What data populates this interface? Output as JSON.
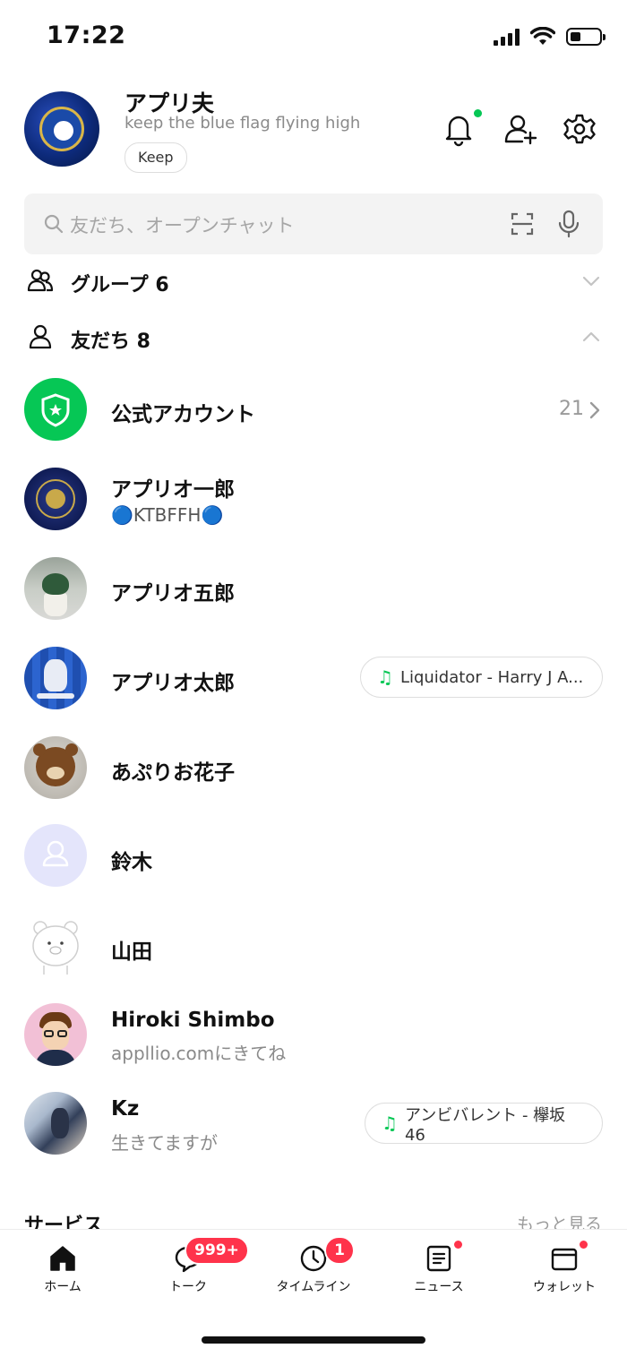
{
  "status_bar": {
    "time": "17:22"
  },
  "profile": {
    "name": "アプリ夫",
    "status_message": "keep the blue flag flying high",
    "keep_label": "Keep"
  },
  "search": {
    "placeholder": "友だち、オープンチャット"
  },
  "sections": {
    "groups": {
      "label": "グループ 6",
      "expanded": false
    },
    "friends": {
      "label": "友だち 8",
      "expanded": true
    }
  },
  "official": {
    "label": "公式アカウント",
    "count": "21"
  },
  "friends": [
    {
      "name": "アプリオ一郎",
      "status": "🔵KTBFFH🔵",
      "music": ""
    },
    {
      "name": "アプリオ五郎",
      "status": "",
      "music": ""
    },
    {
      "name": "アプリオ太郎",
      "status": "",
      "music": "Liquidator - Harry J A..."
    },
    {
      "name": "あぷりお花子",
      "status": "",
      "music": ""
    },
    {
      "name": "鈴木",
      "status": "",
      "music": ""
    },
    {
      "name": "山田",
      "status": "",
      "music": ""
    },
    {
      "name": "Hiroki Shimbo",
      "status": "appllio.comにきてね",
      "music": ""
    },
    {
      "name": "Kz",
      "status": "生きてますが",
      "music": "アンビバレント - 欅坂46"
    }
  ],
  "services": {
    "label": "サービス",
    "more_label": "もっと見る"
  },
  "tabs": [
    {
      "label": "ホーム",
      "icon": "home-icon",
      "active": true
    },
    {
      "label": "トーク",
      "icon": "chat-icon",
      "badge": "999+"
    },
    {
      "label": "タイムライン",
      "icon": "clock-icon",
      "badge": "1"
    },
    {
      "label": "ニュース",
      "icon": "news-icon",
      "dot": true
    },
    {
      "label": "ウォレット",
      "icon": "wallet-icon",
      "dot": true
    }
  ],
  "colors": {
    "accent": "#06c755",
    "badge": "#ff334b",
    "text": "#111111",
    "muted": "#8a8a8a"
  }
}
